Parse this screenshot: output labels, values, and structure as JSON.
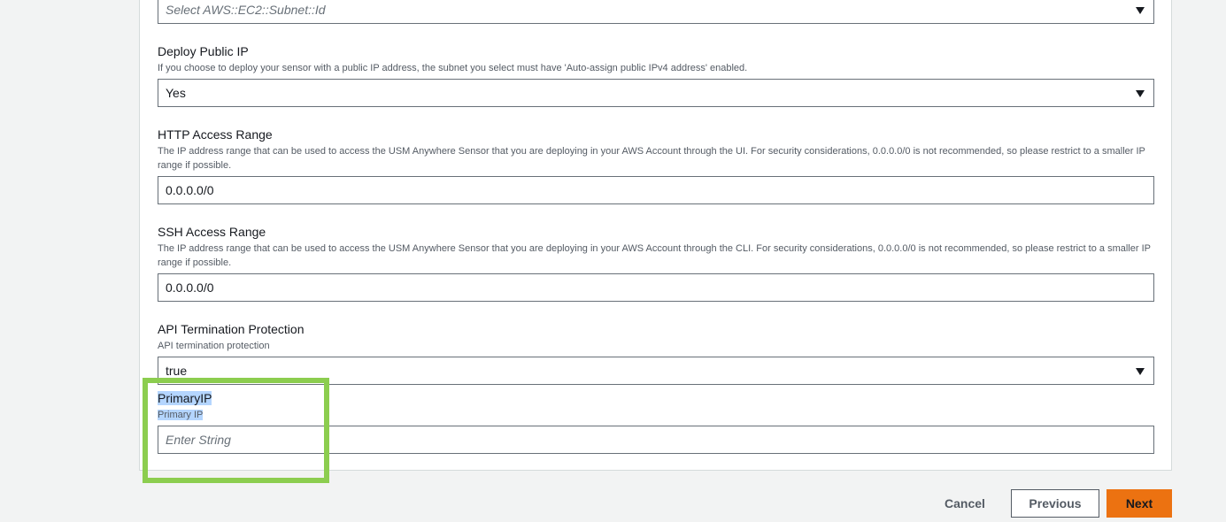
{
  "subnet": {
    "placeholder": "Select AWS::EC2::Subnet::Id"
  },
  "deploy_public_ip": {
    "label": "Deploy Public IP",
    "description": "If you choose to deploy your sensor with a public IP address, the subnet you select must have 'Auto-assign public IPv4 address' enabled.",
    "value": "Yes"
  },
  "http_access_range": {
    "label": "HTTP Access Range",
    "description": "The IP address range that can be used to access the USM Anywhere Sensor that you are deploying in your AWS Account through the UI. For security considerations, 0.0.0.0/0 is not recommended, so please restrict to a smaller IP range if possible.",
    "value": "0.0.0.0/0"
  },
  "ssh_access_range": {
    "label": "SSH Access Range",
    "description": "The IP address range that can be used to access the USM Anywhere Sensor that you are deploying in your AWS Account through the CLI. For security considerations, 0.0.0.0/0 is not recommended, so please restrict to a smaller IP range if possible.",
    "value": "0.0.0.0/0"
  },
  "api_termination_protection": {
    "label": "API Termination Protection",
    "description": "API termination protection",
    "value": "true"
  },
  "primary_ip": {
    "label": "PrimaryIP",
    "description": "Primary IP",
    "placeholder": "Enter String"
  },
  "footer": {
    "cancel": "Cancel",
    "previous": "Previous",
    "next": "Next"
  },
  "colors": {
    "next_button": "#ec7211",
    "highlight_box": "#8ccd4f"
  }
}
